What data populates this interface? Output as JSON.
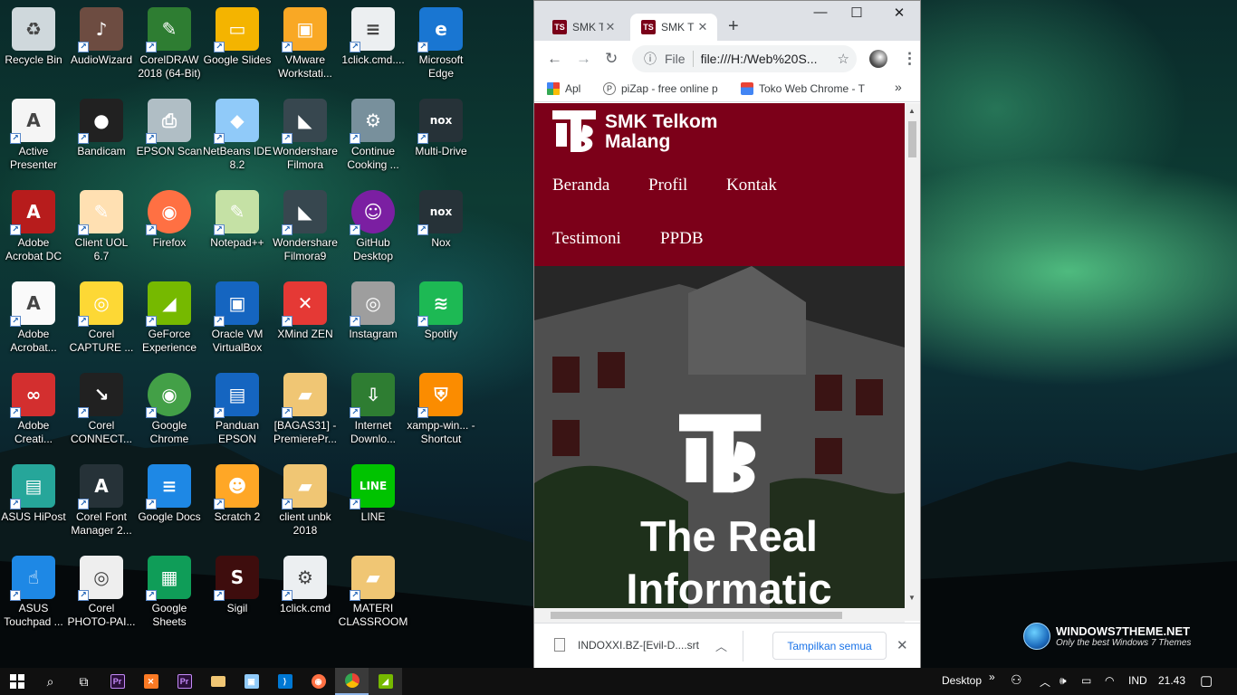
{
  "desktop": {
    "icons": [
      {
        "label": "Recycle Bin",
        "icon": "recycle-bin-icon",
        "color": "#cfd8dc",
        "glyph": "♻"
      },
      {
        "label": "AudioWizard",
        "icon": "audiowizard-icon",
        "color": "#6d4c41",
        "glyph": "♪"
      },
      {
        "label": "CorelDRAW 2018 (64-Bit)",
        "icon": "coreldraw-icon",
        "color": "#2e7d32",
        "glyph": "✎"
      },
      {
        "label": "Google Slides",
        "icon": "google-slides-icon",
        "color": "#f4b400",
        "glyph": "▭"
      },
      {
        "label": "VMware Workstati...",
        "icon": "vmware-icon",
        "color": "#f9a825",
        "glyph": "▣"
      },
      {
        "label": "1click.cmd....",
        "icon": "text-file-icon",
        "color": "#eceff1",
        "glyph": "≡"
      },
      {
        "label": "Microsoft Edge",
        "icon": "edge-icon",
        "color": "#1976d2",
        "glyph": "e"
      },
      {
        "label": "Active Presenter",
        "icon": "active-presenter-icon",
        "color": "#f5f5f5",
        "glyph": "A"
      },
      {
        "label": "Bandicam",
        "icon": "bandicam-icon",
        "color": "#212121",
        "glyph": "●"
      },
      {
        "label": "EPSON Scan",
        "icon": "epson-scan-icon",
        "color": "#b0bec5",
        "glyph": "⎙"
      },
      {
        "label": "NetBeans IDE 8.2",
        "icon": "netbeans-icon",
        "color": "#90caf9",
        "glyph": "◆"
      },
      {
        "label": "Wondershare Filmora",
        "icon": "filmora-icon",
        "color": "#37474f",
        "glyph": "◣"
      },
      {
        "label": "Continue Cooking ...",
        "icon": "installer-icon",
        "color": "#78909c",
        "glyph": "⚙"
      },
      {
        "label": "Multi-Drive",
        "icon": "nox-multi-icon",
        "color": "#263238",
        "glyph": "nox"
      },
      {
        "label": "Adobe Acrobat DC",
        "icon": "acrobat-dc-icon",
        "color": "#b71c1c",
        "glyph": "A"
      },
      {
        "label": "Client UOL 6.7",
        "icon": "client-uol-icon",
        "color": "#ffe0b2",
        "glyph": "✎"
      },
      {
        "label": "Firefox",
        "icon": "firefox-icon",
        "color": "#ff7043",
        "glyph": "◉"
      },
      {
        "label": "Notepad++",
        "icon": "notepadpp-icon",
        "color": "#c5e1a5",
        "glyph": "✎"
      },
      {
        "label": "Wondershare Filmora9",
        "icon": "filmora9-icon",
        "color": "#37474f",
        "glyph": "◣"
      },
      {
        "label": "GitHub Desktop",
        "icon": "github-desktop-icon",
        "color": "#7b1fa2",
        "glyph": "☺"
      },
      {
        "label": "Nox",
        "icon": "nox-icon",
        "color": "#263238",
        "glyph": "nox"
      },
      {
        "label": "Adobe Acrobat...",
        "icon": "acrobat-reader-icon",
        "color": "#fafafa",
        "glyph": "A"
      },
      {
        "label": "Corel CAPTURE ...",
        "icon": "corel-capture-icon",
        "color": "#fdd835",
        "glyph": "◎"
      },
      {
        "label": "GeForce Experience",
        "icon": "geforce-icon",
        "color": "#76b900",
        "glyph": "◢"
      },
      {
        "label": "Oracle VM VirtualBox",
        "icon": "virtualbox-icon",
        "color": "#1565c0",
        "glyph": "▣"
      },
      {
        "label": "XMind ZEN",
        "icon": "xmind-icon",
        "color": "#e53935",
        "glyph": "✕"
      },
      {
        "label": "Instagram",
        "icon": "instagram-icon",
        "color": "#9e9e9e",
        "glyph": "◎"
      },
      {
        "label": "Spotify",
        "icon": "spotify-icon",
        "color": "#1db954",
        "glyph": "≋"
      },
      {
        "label": "Adobe Creati...",
        "icon": "creative-cloud-icon",
        "color": "#d32f2f",
        "glyph": "∞"
      },
      {
        "label": "Corel CONNECT...",
        "icon": "corel-connect-icon",
        "color": "#212121",
        "glyph": "↘"
      },
      {
        "label": "Google Chrome",
        "icon": "chrome-icon",
        "color": "#43a047",
        "glyph": "◉"
      },
      {
        "label": "Panduan EPSON",
        "icon": "epson-guide-icon",
        "color": "#1565c0",
        "glyph": "▤"
      },
      {
        "label": "[BAGAS31] - PremierePr...",
        "icon": "folder-icon",
        "color": "#f0c674",
        "glyph": "▰"
      },
      {
        "label": "Internet Downlo...",
        "icon": "idm-icon",
        "color": "#2e7d32",
        "glyph": "⇩"
      },
      {
        "label": "xampp-win... - Shortcut",
        "icon": "xampp-shortcut-icon",
        "color": "#fb8c00",
        "glyph": "⛨"
      },
      {
        "label": "ASUS HiPost",
        "icon": "asus-hipost-icon",
        "color": "#26a69a",
        "glyph": "▤"
      },
      {
        "label": "Corel Font Manager 2...",
        "icon": "corel-font-icon",
        "color": "#263238",
        "glyph": "A"
      },
      {
        "label": "Google Docs",
        "icon": "google-docs-icon",
        "color": "#1e88e5",
        "glyph": "≡"
      },
      {
        "label": "Scratch 2",
        "icon": "scratch-icon",
        "color": "#ffa726",
        "glyph": "☻"
      },
      {
        "label": "client unbk 2018",
        "icon": "folder-icon",
        "color": "#f0c674",
        "glyph": "▰"
      },
      {
        "label": "LINE",
        "icon": "line-icon",
        "color": "#00c300",
        "glyph": "LINE"
      },
      {
        "label": "",
        "icon": "",
        "color": "",
        "glyph": ""
      },
      {
        "label": "ASUS Touchpad ...",
        "icon": "asus-touchpad-icon",
        "color": "#1e88e5",
        "glyph": "☝"
      },
      {
        "label": "Corel PHOTO-PAI...",
        "icon": "corel-photopaint-icon",
        "color": "#eeeeee",
        "glyph": "◎"
      },
      {
        "label": "Google Sheets",
        "icon": "google-sheets-icon",
        "color": "#0f9d58",
        "glyph": "▦"
      },
      {
        "label": "Sigil",
        "icon": "sigil-icon",
        "color": "#3e0d0d",
        "glyph": "S"
      },
      {
        "label": "1click.cmd",
        "icon": "cmd-file-icon",
        "color": "#eceff1",
        "glyph": "⚙"
      },
      {
        "label": "MATERI CLASSROOM",
        "icon": "folder-icon",
        "color": "#f0c674",
        "glyph": "▰"
      }
    ]
  },
  "browser": {
    "tabs": [
      {
        "label": "SMK T",
        "active": false
      },
      {
        "label": "SMK T",
        "active": true
      }
    ],
    "new_tab_glyph": "+",
    "window_controls": {
      "minimize": "—",
      "maximize": "☐",
      "close": "✕"
    },
    "omnibox": {
      "scheme_label": "File",
      "url": "file:///H:/Web%20S..."
    },
    "bookmarks": [
      {
        "label": "Apl",
        "icon": "apps-grid-icon"
      },
      {
        "label": "piZap - free online p",
        "icon": "pizap-icon"
      },
      {
        "label": "Toko Web Chrome - T",
        "icon": "webstore-icon"
      }
    ],
    "bookmarks_overflow": "»",
    "page": {
      "brand_line1": "SMK Telkom",
      "brand_line2": "Malang",
      "nav": [
        "Beranda",
        "Profil",
        "Kontak",
        "Testimoni",
        "PPDB"
      ],
      "hero_line1": "The Real",
      "hero_line2": "Informatic",
      "brand_color": "#7c0019"
    },
    "download_bar": {
      "filename": "INDOXXI.BZ-[Evil-D....srt",
      "show_all": "Tampilkan semua"
    }
  },
  "watermark": {
    "title": "WINDOWS7THEME.NET",
    "subtitle": "Only the best Windows 7 Themes"
  },
  "taskbar": {
    "desktop_label": "Desktop",
    "language": "IND",
    "time": "21.43"
  }
}
